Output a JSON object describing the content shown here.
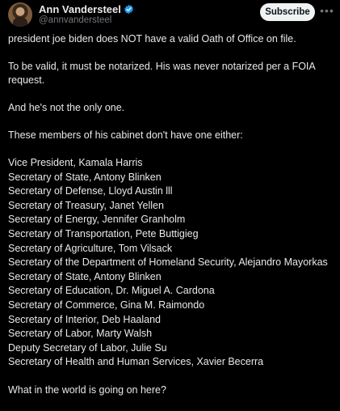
{
  "post": {
    "author": {
      "display_name": "Ann Vandersteel",
      "handle": "@annvandersteel",
      "avatar_icon": "avatar",
      "verified_icon": "verified-badge-icon",
      "verified_color": "#1d9bf0"
    },
    "subscribe_label": "Subscribe",
    "more_icon": "more-options-icon",
    "paragraphs": [
      "president joe biden does NOT have a valid Oath of Office on file.",
      "To be valid, it must be notarized. His was never notarized per a FOIA request.",
      "And he's not the only one.",
      "These members of his cabinet don't have one either:"
    ],
    "cabinet_list": [
      "Vice President, Kamala Harris",
      "Secretary of State, Antony Blinken",
      "Secretary of Defense, Lloyd Austin lll",
      "Secretary of Treasury, Janet Yellen",
      "Secretary of Energy, Jennifer Granholm",
      "Secretary of Transportation, Pete Buttigieg",
      "Secretary of Agriculture, Tom Vilsack",
      "Secretary of the Department of Homeland Security, Alejandro Mayorkas",
      "Secretary of State, Antony Blinken",
      "Secretary of Education, Dr. Miguel A. Cardona",
      "Secretary of Commerce, Gina M. Raimondo",
      "Secretary of Interior, Deb Haaland",
      "Secretary of Labor, Marty Walsh",
      "Deputy Secretary of Labor, Julie Su",
      "Secretary of Health and Human Services, Xavier Becerra"
    ],
    "closing": "What in the world is going on here?"
  },
  "colors": {
    "background": "#000000",
    "text": "#e7e9ea",
    "secondary_text": "#71767b",
    "button_bg": "#eff3f4",
    "button_text": "#0f1419"
  }
}
